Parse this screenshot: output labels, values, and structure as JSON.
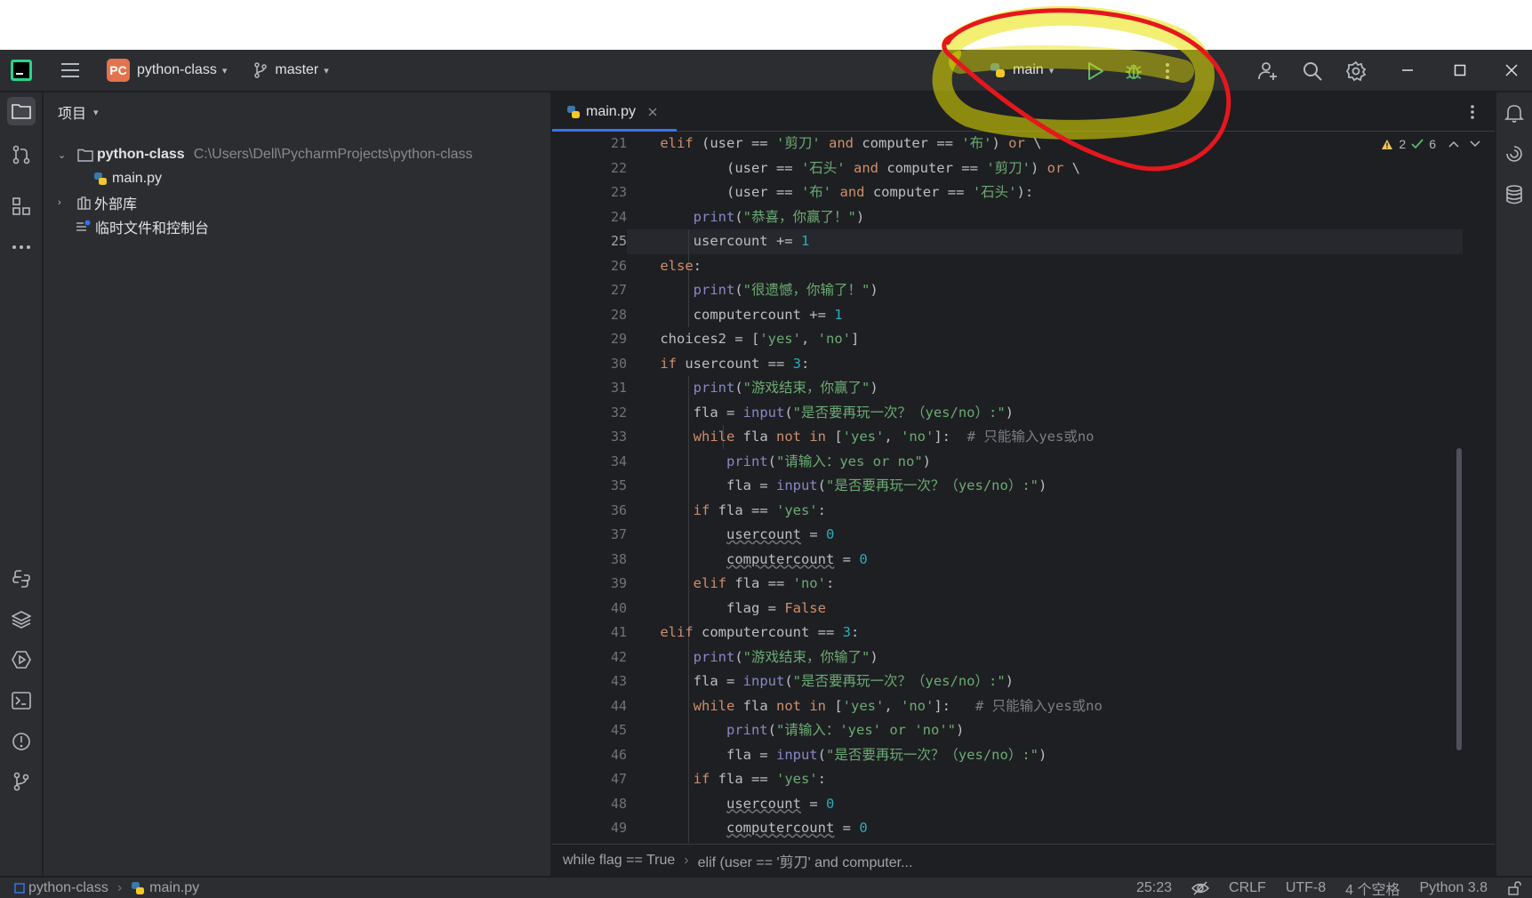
{
  "titlebar": {
    "project_badge": "PC",
    "project_name": "python-class",
    "branch": "master",
    "run_config": "main"
  },
  "project_panel": {
    "header": "项目",
    "root_name": "python-class",
    "root_path": "C:\\Users\\Dell\\PycharmProjects\\python-class",
    "file": "main.py",
    "external_libs": "外部库",
    "scratches": "临时文件和控制台"
  },
  "editor": {
    "tab_label": "main.py",
    "warnings": "2",
    "checks": "6",
    "current_line": "25",
    "lines": [
      {
        "n": "21",
        "html": "    <span class=\"kw\">elif</span> (user == <span class=\"st\">'剪刀'</span> <span class=\"kw\">and</span> computer == <span class=\"st\">'布'</span>) <span class=\"kw\">or</span> \\"
      },
      {
        "n": "22",
        "html": "            (user == <span class=\"st\">'石头'</span> <span class=\"kw\">and</span> computer == <span class=\"st\">'剪刀'</span>) <span class=\"kw\">or</span> \\"
      },
      {
        "n": "23",
        "html": "            (user == <span class=\"st\">'布'</span> <span class=\"kw\">and</span> computer == <span class=\"st\">'石头'</span>):"
      },
      {
        "n": "24",
        "html": "        <span class=\"fn\">print</span>(<span class=\"st\">\"恭喜，你赢了！\"</span>)"
      },
      {
        "n": "25",
        "html": "        usercount += <span class=\"nu\">1</span>"
      },
      {
        "n": "26",
        "html": "    <span class=\"kw\">else</span>:"
      },
      {
        "n": "27",
        "html": "        <span class=\"fn\">print</span>(<span class=\"st\">\"很遗憾，你输了！\"</span>)"
      },
      {
        "n": "28",
        "html": "        computercount += <span class=\"nu\">1</span>"
      },
      {
        "n": "29",
        "html": "    choices2 = [<span class=\"st\">'yes'</span>, <span class=\"st\">'no'</span>]"
      },
      {
        "n": "30",
        "html": "    <span class=\"kw\">if</span> usercount == <span class=\"nu\">3</span>:"
      },
      {
        "n": "31",
        "html": "        <span class=\"fn\">print</span>(<span class=\"st\">\"游戏结束，你赢了\"</span>)"
      },
      {
        "n": "32",
        "html": "        fla = <span class=\"fn\">input</span>(<span class=\"st\">\"是否要再玩一次？（yes/no）:\"</span>)"
      },
      {
        "n": "33",
        "html": "        <span class=\"kw\">while</span> fla <span class=\"kw\">not in</span> [<span class=\"st\">'yes'</span>, <span class=\"st\">'no'</span>]:  <span class=\"cm\"># 只能输入yes或no</span>"
      },
      {
        "n": "34",
        "html": "            <span class=\"fn\">print</span>(<span class=\"st\">\"请输入：yes or no\"</span>)"
      },
      {
        "n": "35",
        "html": "            fla = <span class=\"fn\">input</span>(<span class=\"st\">\"是否要再玩一次？（yes/no）:\"</span>)"
      },
      {
        "n": "36",
        "html": "        <span class=\"kw\">if</span> fla == <span class=\"st\">'yes'</span>:"
      },
      {
        "n": "37",
        "html": "            <span class=\"ul\">usercount</span> = <span class=\"nu\">0</span>"
      },
      {
        "n": "38",
        "html": "            <span class=\"ul\">computercount</span> = <span class=\"nu\">0</span>"
      },
      {
        "n": "39",
        "html": "        <span class=\"kw\">elif</span> fla == <span class=\"st\">'no'</span>:"
      },
      {
        "n": "40",
        "html": "            flag = <span class=\"kw\">False</span>"
      },
      {
        "n": "41",
        "html": "    <span class=\"kw\">elif</span> computercount == <span class=\"nu\">3</span>:"
      },
      {
        "n": "42",
        "html": "        <span class=\"fn\">print</span>(<span class=\"st\">\"游戏结束，你输了\"</span>)"
      },
      {
        "n": "43",
        "html": "        fla = <span class=\"fn\">input</span>(<span class=\"st\">\"是否要再玩一次？（yes/no）:\"</span>)"
      },
      {
        "n": "44",
        "html": "        <span class=\"kw\">while</span> fla <span class=\"kw\">not in</span> [<span class=\"st\">'yes'</span>, <span class=\"st\">'no'</span>]:   <span class=\"cm\"># 只能输入yes或no</span>"
      },
      {
        "n": "45",
        "html": "            <span class=\"fn\">print</span>(<span class=\"st\">\"请输入：'yes' or 'no'\"</span>)"
      },
      {
        "n": "46",
        "html": "            fla = <span class=\"fn\">input</span>(<span class=\"st\">\"是否要再玩一次？（yes/no）:\"</span>)"
      },
      {
        "n": "47",
        "html": "        <span class=\"kw\">if</span> fla == <span class=\"st\">'yes'</span>:"
      },
      {
        "n": "48",
        "html": "            <span class=\"ul\">usercount</span> = <span class=\"nu\">0</span>"
      },
      {
        "n": "49",
        "html": "            <span class=\"ul\">computercount</span> = <span class=\"nu\">0</span>"
      }
    ],
    "breadcrumb": [
      "while flag == True",
      "elif (user == '剪刀' and computer..."
    ]
  },
  "statusbar": {
    "crumb_project": "python-class",
    "crumb_file": "main.py",
    "position": "25:23",
    "line_sep": "CRLF",
    "encoding": "UTF-8",
    "indent": "4 个空格",
    "interpreter": "Python 3.8"
  },
  "colors": {
    "background": "#1e1f22",
    "panel": "#2b2d30",
    "keyword": "#cf8e6d",
    "string": "#6aab73",
    "number": "#2aacb8",
    "accent": "#3574f0",
    "annotation_red": "#e5171e",
    "annotation_yellow": "#e8e200"
  }
}
